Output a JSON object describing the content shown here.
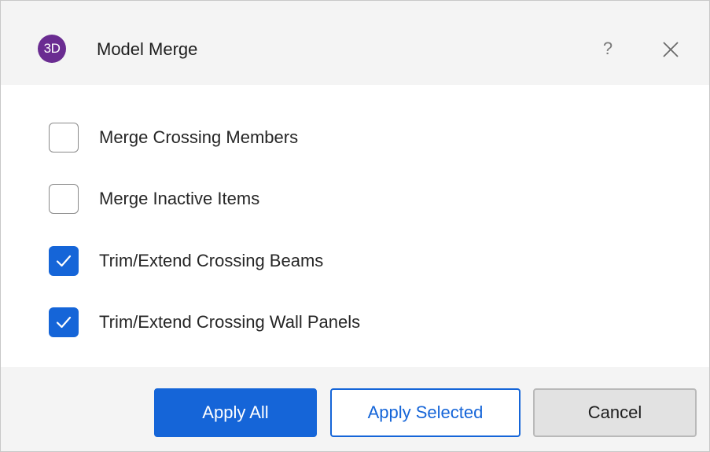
{
  "window": {
    "app_badge": "3D",
    "title": "Model Merge",
    "help_label": "?",
    "close_icon": "close-icon"
  },
  "options": [
    {
      "label": "Merge Crossing Members",
      "checked": false
    },
    {
      "label": "Merge Inactive Items",
      "checked": false
    },
    {
      "label": "Trim/Extend Crossing Beams",
      "checked": true
    },
    {
      "label": "Trim/Extend Crossing Wall Panels",
      "checked": true
    }
  ],
  "buttons": {
    "apply_all": "Apply All",
    "apply_selected": "Apply Selected",
    "cancel": "Cancel"
  },
  "colors": {
    "accent": "#1565d8",
    "badge": "#6a2c91"
  }
}
